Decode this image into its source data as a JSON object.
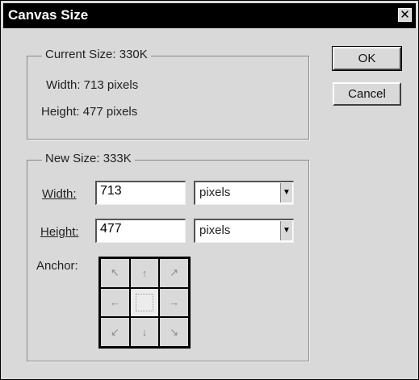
{
  "window": {
    "title": "Canvas Size",
    "close_glyph": "✕"
  },
  "current_size": {
    "legend": "Current Size: 330K",
    "width_text": "Width: 713 pixels",
    "height_text": "Height: 477 pixels"
  },
  "new_size": {
    "legend": "New Size: 333K",
    "width_label": "Width:",
    "width_value": "713",
    "width_unit": "pixels",
    "height_label": "Height:",
    "height_value": "477",
    "height_unit": "pixels",
    "anchor_label": "Anchor:"
  },
  "buttons": {
    "ok": "OK",
    "cancel": "Cancel"
  },
  "anchor": {
    "selected": "center",
    "arrows": [
      "↖",
      "↑",
      "↗",
      "←",
      "",
      "→",
      "↙",
      "↓",
      "↘"
    ]
  }
}
